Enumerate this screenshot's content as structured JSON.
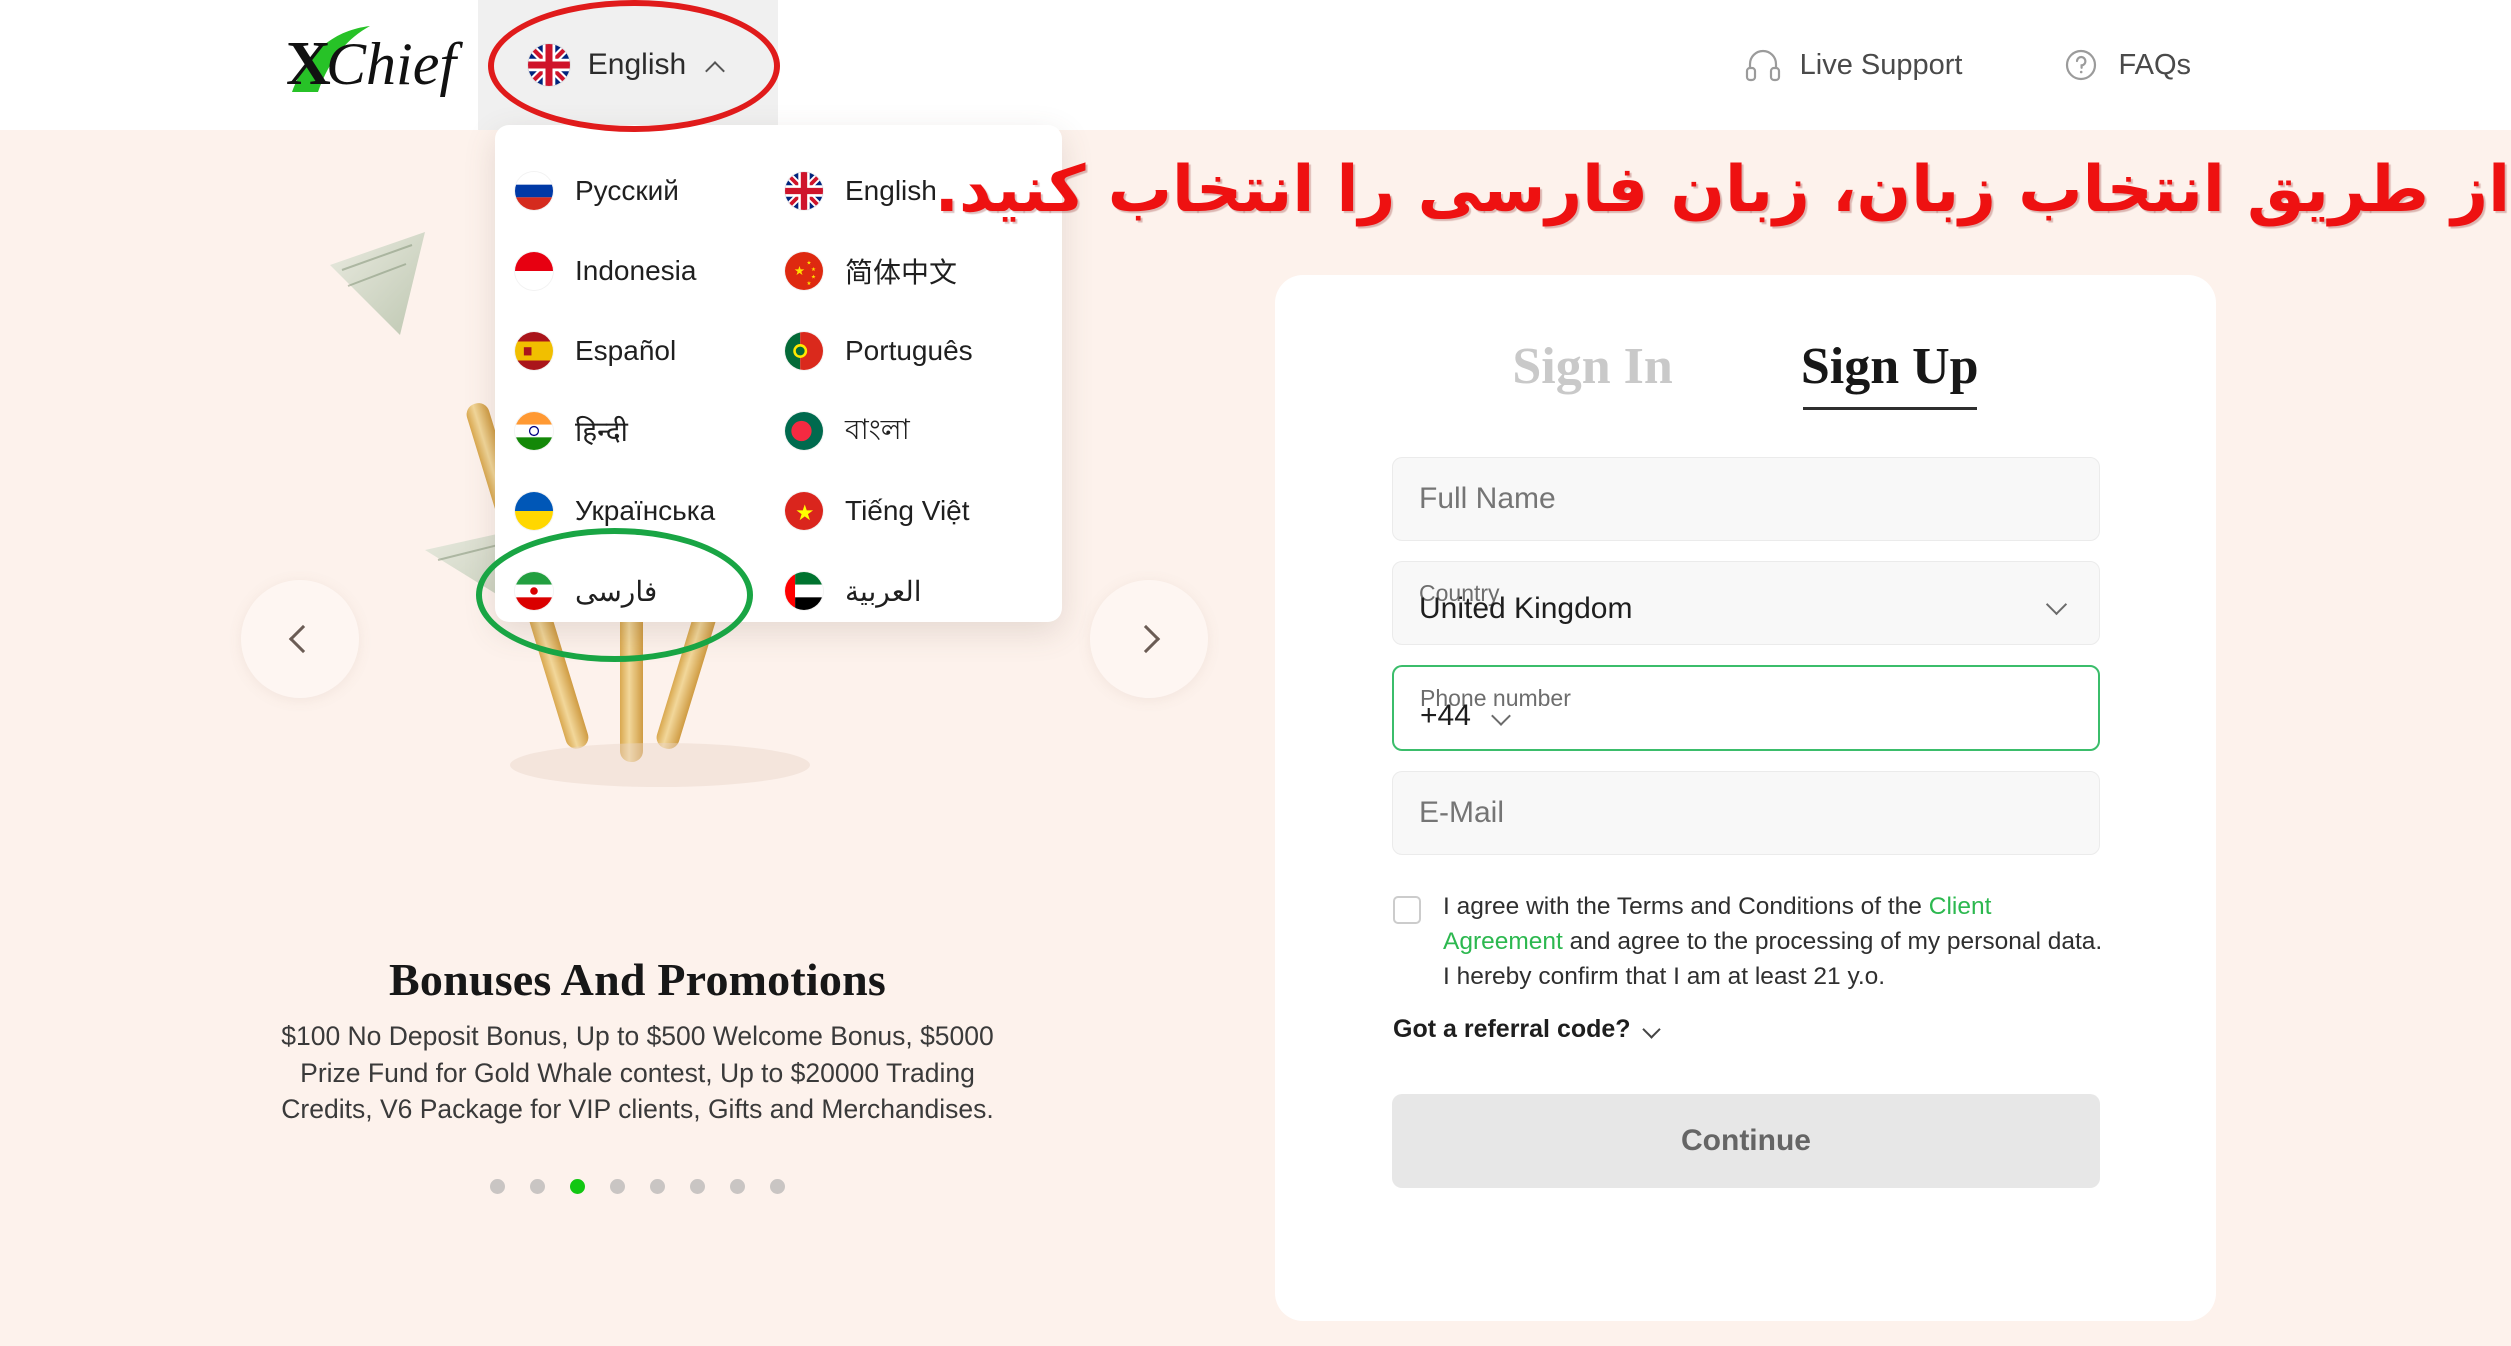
{
  "brand": {
    "name": "xChief"
  },
  "header": {
    "language_button": {
      "label": "English",
      "flag": "gb",
      "chevron": "chevron-up-icon"
    },
    "links": [
      {
        "label": "Live Support",
        "icon": "headset-icon"
      },
      {
        "label": "FAQs",
        "icon": "question-circle-icon"
      }
    ]
  },
  "language_dropdown": {
    "items": [
      {
        "label": "Русский",
        "flag": "ru",
        "rtl": false
      },
      {
        "label": "English",
        "flag": "gb",
        "rtl": false
      },
      {
        "label": "Indonesia",
        "flag": "id",
        "rtl": false
      },
      {
        "label": "简体中文",
        "flag": "cn",
        "rtl": false
      },
      {
        "label": "Español",
        "flag": "es",
        "rtl": false
      },
      {
        "label": "Português",
        "flag": "pt",
        "rtl": false
      },
      {
        "label": "हिन्दी",
        "flag": "in",
        "rtl": false
      },
      {
        "label": "বাংলা",
        "flag": "bd",
        "rtl": false
      },
      {
        "label": "Українська",
        "flag": "ua",
        "rtl": false
      },
      {
        "label": "Tiếng Việt",
        "flag": "vn",
        "rtl": false
      },
      {
        "label": "فارسی",
        "flag": "ir",
        "rtl": true
      },
      {
        "label": "العربية",
        "flag": "ae",
        "rtl": true
      }
    ]
  },
  "annotation": {
    "text": "از طریق انتخاب زبان، زبان فارسی را انتخاب کنید.",
    "red_highlight_target": "language-button",
    "green_highlight_target": "language-item-farsi",
    "red_color": "#e01b1b",
    "green_color": "#19a544"
  },
  "hero": {
    "title": "Bonuses And Promotions",
    "description": "$100 No Deposit Bonus, Up to $500 Welcome Bonus, $5000 Prize Fund for Gold Whale contest, Up to $20000 Trading Credits, V6 Package for VIP clients, Gifts and Merchandises.",
    "carousel": {
      "prev_icon": "chevron-left-icon",
      "next_icon": "chevron-right-icon",
      "dot_count": 8,
      "active_dot_index": 2,
      "active_dot_color": "#12c712",
      "inactive_dot_color": "#c9c5c3"
    }
  },
  "signup": {
    "tabs": [
      {
        "label": "Sign In",
        "active": false
      },
      {
        "label": "Sign Up",
        "active": true
      }
    ],
    "fields": {
      "full_name": {
        "placeholder": "Full Name",
        "value": ""
      },
      "country": {
        "label": "Country",
        "value": "United Kingdom",
        "chevron": "chevron-down-icon"
      },
      "phone_number": {
        "label": "Phone number",
        "value": "+44",
        "chevron": "chevron-down-icon",
        "focused": true
      },
      "email": {
        "placeholder": "E-Mail",
        "value": ""
      }
    },
    "agreement": {
      "checked": false,
      "text_before_link": "I agree with the Terms and Conditions of the ",
      "link_text": "Client Agreement",
      "text_after_link": " and agree to the processing of my personal data.",
      "second_line": "I hereby confirm that I am at least 21 y.o.",
      "link_color": "#2cb84f"
    },
    "referral": {
      "label": "Got a referral code?",
      "chevron": "chevron-down-icon"
    },
    "submit": {
      "label": "Continue",
      "enabled": false
    }
  },
  "colors": {
    "page_background": "#fdf2ec",
    "card_background": "#ffffff",
    "accent_green": "#2cb84f",
    "field_background": "#f8f8f8"
  }
}
